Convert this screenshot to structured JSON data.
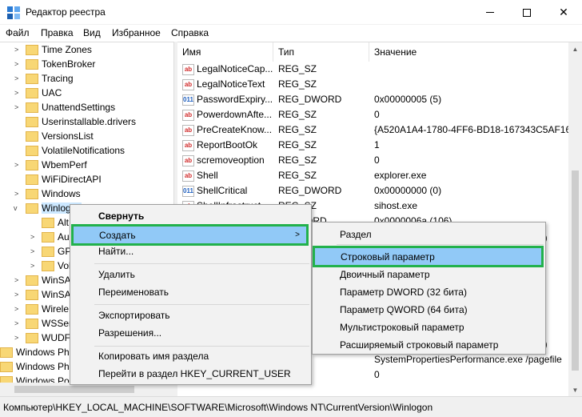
{
  "window": {
    "title": "Редактор реестра"
  },
  "menu": [
    "Файл",
    "Правка",
    "Вид",
    "Избранное",
    "Справка"
  ],
  "tree": [
    "Time Zones",
    "TokenBroker",
    "Tracing",
    "UAC",
    "UnattendSettings",
    "Userinstallable.drivers",
    "VersionsList",
    "VolatileNotifications",
    "WbemPerf",
    "WiFiDirectAPI",
    "Windows",
    "Winlogon",
    "Alt",
    "Au",
    "GP",
    "Vol",
    "WinSA",
    "WinSA",
    "Wirele",
    "WSServ",
    "WUDF",
    "Windows Pho",
    "Windows Pho",
    "Windows Port"
  ],
  "columns": {
    "name": "Имя",
    "type": "Тип",
    "value": "Значение"
  },
  "rows": [
    {
      "icon": "ab",
      "name": "LegalNoticeCap...",
      "type": "REG_SZ",
      "value": ""
    },
    {
      "icon": "ab",
      "name": "LegalNoticeText",
      "type": "REG_SZ",
      "value": ""
    },
    {
      "icon": "011",
      "name": "PasswordExpiry...",
      "type": "REG_DWORD",
      "value": "0x00000005 (5)"
    },
    {
      "icon": "ab",
      "name": "PowerdownAfte...",
      "type": "REG_SZ",
      "value": "0"
    },
    {
      "icon": "ab",
      "name": "PreCreateKnow...",
      "type": "REG_SZ",
      "value": "{A520A1A4-1780-4FF6-BD18-167343C5AF16}"
    },
    {
      "icon": "ab",
      "name": "ReportBootOk",
      "type": "REG_SZ",
      "value": "1"
    },
    {
      "icon": "ab",
      "name": "scremoveoption",
      "type": "REG_SZ",
      "value": "0"
    },
    {
      "icon": "ab",
      "name": "Shell",
      "type": "REG_SZ",
      "value": "explorer.exe"
    },
    {
      "icon": "011",
      "name": "ShellCritical",
      "type": "REG_DWORD",
      "value": "0x00000000 (0)"
    },
    {
      "icon": "ab",
      "name": "ShellInfrastruct...",
      "type": "REG_SZ",
      "value": "sihost.exe"
    },
    {
      "icon": "011",
      "name": "",
      "type": "ORD",
      "value": "0x0000006a (106)"
    }
  ],
  "obscured_values": [
    "9)",
    "3)",
    "SystemPropertiesPerformance.exe /pagefile",
    "0"
  ],
  "context_menu": {
    "items": [
      "Свернуть",
      "Создать",
      "Найти...",
      "Удалить",
      "Переименовать",
      "Экспортировать",
      "Разрешения...",
      "Копировать имя раздела",
      "Перейти в раздел HKEY_CURRENT_USER"
    ],
    "submenu_arrow": ">"
  },
  "submenu": {
    "items": [
      "Раздел",
      "Строковый параметр",
      "Двоичный параметр",
      "Параметр DWORD (32 бита)",
      "Параметр QWORD (64 бита)",
      "Мультистроковый параметр",
      "Расширяемый строковый параметр"
    ]
  },
  "status": "Компьютер\\HKEY_LOCAL_MACHINE\\SOFTWARE\\Microsoft\\Windows NT\\CurrentVersion\\Winlogon",
  "colors": {
    "highlight": "#91c9f7",
    "annotation": "#22b14c",
    "folder": "#f8d775"
  }
}
